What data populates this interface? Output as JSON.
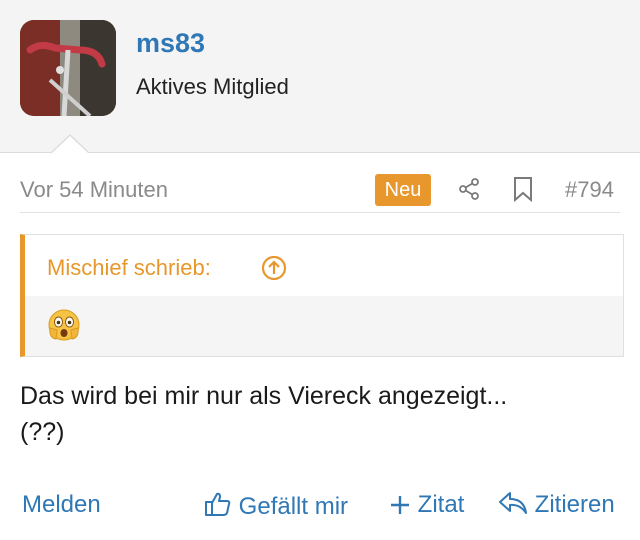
{
  "user": {
    "name": "ms83",
    "title": "Aktives Mitglied"
  },
  "post": {
    "time": "Vor 54 Minuten",
    "badge": "Neu",
    "number": "#794",
    "quote": {
      "author_line": "Mischief schrieb:",
      "emoji": "shocked-emoji"
    },
    "message_line1": "Das wird bei mir nur als Viereck angezeigt...",
    "message_line2": "(??)"
  },
  "actions": {
    "report": "Melden",
    "like": "Gefällt mir",
    "quote": "Zitat",
    "reply": "Zitieren"
  },
  "colors": {
    "link": "#2f77b5",
    "accent": "#e8972c",
    "muted": "#8a8a8a"
  },
  "icons": [
    "share-icon",
    "bookmark-icon",
    "arrow-up-circle-icon",
    "thumbs-up-icon",
    "plus-icon",
    "reply-icon"
  ]
}
